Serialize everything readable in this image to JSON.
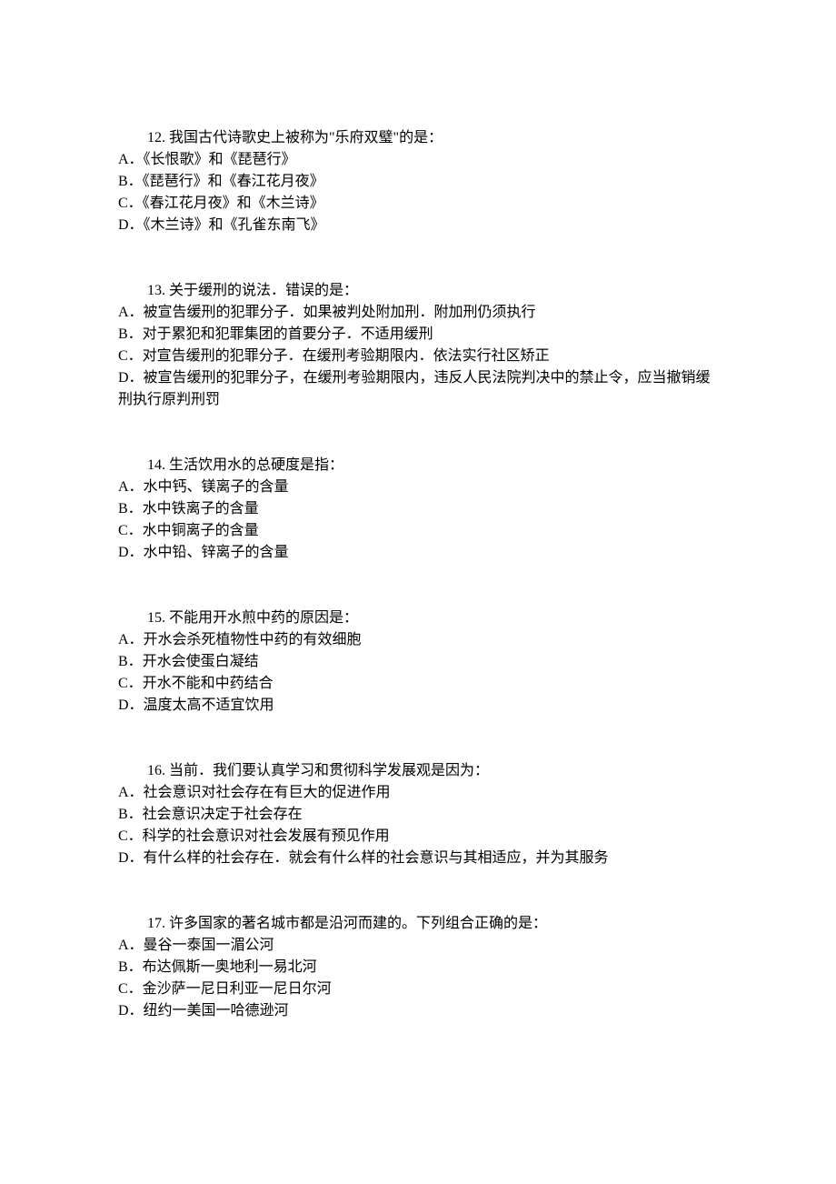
{
  "questions": [
    {
      "number": "12.",
      "text": "我国古代诗歌史上被称为\"乐府双璧\"的是：",
      "options": [
        "A．《长恨歌》和《琵琶行》",
        "B．《琵琶行》和《春江花月夜》",
        "C．《春江花月夜》和《木兰诗》",
        "D．《木兰诗》和《孔雀东南飞》"
      ]
    },
    {
      "number": "13.",
      "text": "关于缓刑的说法．错误的是：",
      "options": [
        "A．被宣告缓刑的犯罪分子．如果被判处附加刑．附加刑仍须执行",
        "B．对于累犯和犯罪集团的首要分子．不适用缓刑",
        "C．对宣告缓刑的犯罪分子．在缓刑考验期限内．依法实行社区矫正",
        "D．被宣告缓刑的犯罪分子，在缓刑考验期限内，违反人民法院判决中的禁止令，应当撤销缓刑执行原判刑罚"
      ]
    },
    {
      "number": "14.",
      "text": "生活饮用水的总硬度是指：",
      "options": [
        "A．水中钙、镁离子的含量",
        "B．水中铁离子的含量",
        "C．水中铜离子的含量",
        "D．水中铅、锌离子的含量"
      ]
    },
    {
      "number": "15.",
      "text": "不能用开水煎中药的原因是：",
      "options": [
        "A．开水会杀死植物性中药的有效细胞",
        "B．开水会使蛋白凝结",
        "C．开水不能和中药结合",
        "D．温度太高不适宜饮用"
      ]
    },
    {
      "number": "16.",
      "text": "当前．我们要认真学习和贯彻科学发展观是因为：",
      "options": [
        "A．社会意识对社会存在有巨大的促进作用",
        "B．社会意识决定于社会存在",
        "C．科学的社会意识对社会发展有预见作用",
        "D．有什么样的社会存在．就会有什么样的社会意识与其相适应，并为其服务"
      ]
    },
    {
      "number": "17.",
      "text": "许多国家的著名城市都是沿河而建的。下列组合正确的是：",
      "options": [
        "A．曼谷一泰国一湄公河",
        "B．布达佩斯一奥地利一易北河",
        "C．金沙萨一尼日利亚一尼日尔河",
        "D．纽约一美国一哈德逊河"
      ]
    }
  ]
}
